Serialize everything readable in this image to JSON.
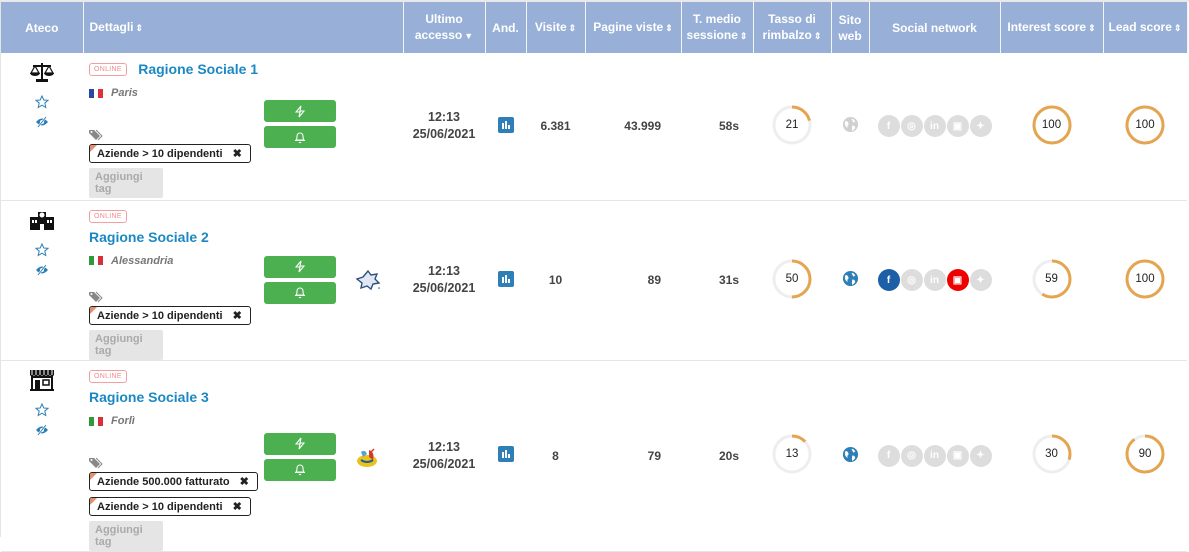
{
  "table": {
    "headers": {
      "ateco": "Ateco",
      "dettagli": "Dettagli",
      "ultimo_accesso": "Ultimo accesso",
      "and": "And.",
      "visite": "Visite",
      "pagine_viste": "Pagine viste",
      "t_medio_sessione": "T. medio sessione",
      "tasso_rimbalzo": "Tasso di rimbalzo",
      "sito_web": "Sito web",
      "social_network": "Social network",
      "interest_score": "Interest score",
      "lead_score": "Lead score"
    },
    "sort_icon": "⇕",
    "sort_desc_icon": "▼",
    "rows": [
      {
        "ateco_icon": "scales-icon",
        "status_badge": "ONLINE",
        "name": "Ragione Sociale 1",
        "country_flag": "france",
        "city": "Paris",
        "tags": [
          "Aziende > 10 dipendenti"
        ],
        "add_tag_label": "Aggiungi tag",
        "last_access_time": "12:13",
        "last_access_date": "25/06/2021",
        "visits": "6.381",
        "page_views": "43.999",
        "avg_session": "58s",
        "bounce_rate": 21,
        "website_active": false,
        "socials": {
          "facebook": false,
          "instagram": false,
          "linkedin": false,
          "youtube": false,
          "twitter": false
        },
        "interest_score": 100,
        "lead_score": 100
      },
      {
        "ateco_icon": "school-building-icon",
        "status_badge": "ONLINE",
        "name": "Ragione Sociale 2",
        "country_flag": "italy",
        "city": "Alessandria",
        "tags": [
          "Aziende > 10 dipendenti"
        ],
        "add_tag_label": "Aggiungi tag",
        "andamento_icon": "badge-logo-icon",
        "last_access_time": "12:13",
        "last_access_date": "25/06/2021",
        "visits": "10",
        "page_views": "89",
        "avg_session": "31s",
        "bounce_rate": 50,
        "website_active": true,
        "socials": {
          "facebook": true,
          "instagram": false,
          "linkedin": false,
          "youtube": true,
          "twitter": false
        },
        "interest_score": 59,
        "lead_score": 100
      },
      {
        "ateco_icon": "shop-icon",
        "status_badge": "ONLINE",
        "name": "Ragione Sociale 3",
        "country_flag": "italy",
        "city": "Forlì",
        "tags": [
          "Aziende 500.000 fatturato",
          "Aziende > 10 dipendenti"
        ],
        "add_tag_label": "Aggiungi tag",
        "andamento_icon": "colorful-logo-icon",
        "last_access_time": "12:13",
        "last_access_date": "25/06/2021",
        "visits": "8",
        "page_views": "79",
        "avg_session": "20s",
        "bounce_rate": 13,
        "website_active": true,
        "socials": {
          "facebook": false,
          "instagram": false,
          "linkedin": false,
          "youtube": false,
          "twitter": false
        },
        "interest_score": 30,
        "lead_score": 90
      }
    ]
  },
  "colors": {
    "header_bg": "#98b0d8",
    "link_blue": "#1b88c4",
    "green_button": "#4caf50",
    "score_ring": "#e5a550",
    "ring_track": "#eeeeee",
    "social_inactive": "#dddddd",
    "facebook": "#1d5fa7",
    "youtube": "#ee0000"
  }
}
